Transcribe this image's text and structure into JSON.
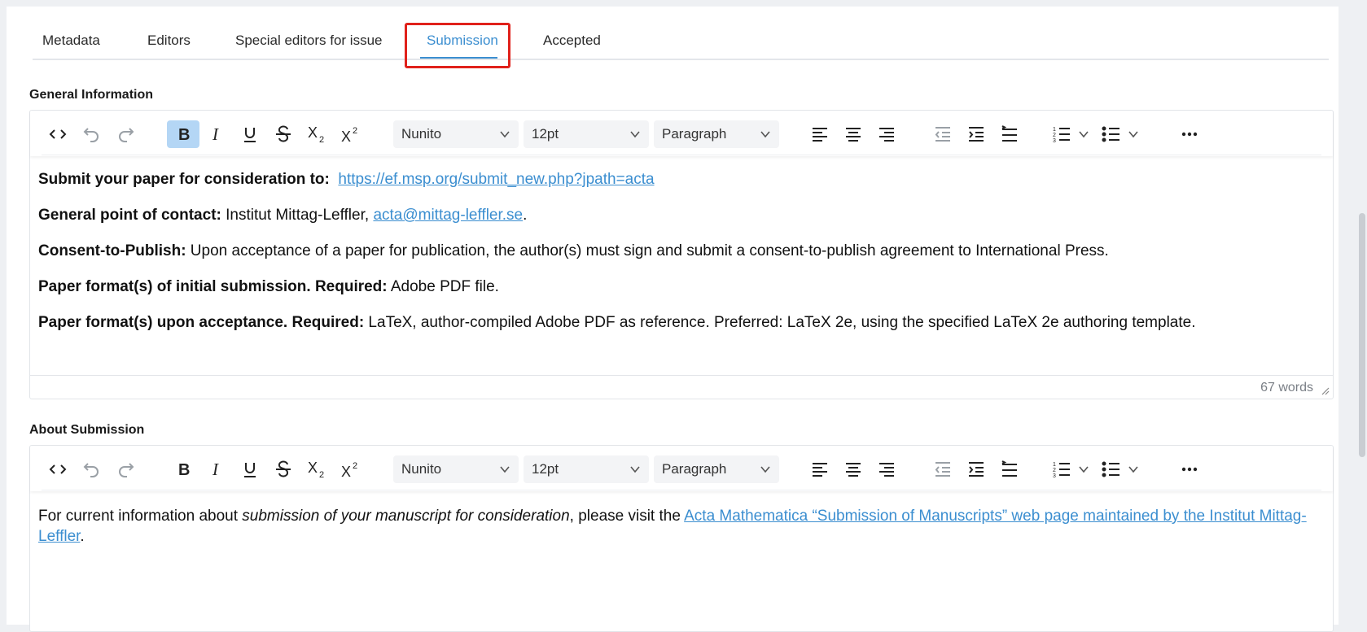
{
  "tabs": [
    {
      "label": "Metadata"
    },
    {
      "label": "Editors"
    },
    {
      "label": "Special editors for issue"
    },
    {
      "label": "Submission"
    },
    {
      "label": "Accepted"
    }
  ],
  "active_tab": "Submission",
  "colors": {
    "accent": "#3b8ed0",
    "highlight": "#e0211b",
    "active_button": "#b4d6f5"
  },
  "toolbar": {
    "font": "Nunito",
    "size": "12pt",
    "block": "Paragraph",
    "icons": [
      "source-code",
      "undo",
      "redo",
      "bold",
      "italic",
      "underline",
      "strikethrough",
      "subscript",
      "superscript",
      "align-left",
      "align-center",
      "align-right",
      "outdent",
      "indent",
      "line-height",
      "numbered-list",
      "bullet-list",
      "more"
    ]
  },
  "general": {
    "label": "General Information",
    "p1_bold": "Submit your paper for consideration to:",
    "p1_link": "https://ef.msp.org/submit_new.php?jpath=acta",
    "p2_bold": "General point of contact:",
    "p2_text": " Institut Mittag-Leffler, ",
    "p2_link": "acta@mittag-leffler.se",
    "p2_end": ".",
    "p3_bold": "Consent-to-Publish:",
    "p3_text": " Upon acceptance of a paper for publication, the author(s) must sign and submit a consent-to-publish agreement to International Press.",
    "p4_bold": "Paper format(s) of initial submission. Required:",
    "p4_text": " Adobe PDF file.",
    "p5_bold": "Paper format(s) upon acceptance. Required:",
    "p5_text": " LaTeX, author-compiled Adobe PDF as reference. Preferred: LaTeX 2e, using the specified LaTeX 2e authoring template.",
    "word_count": "67 words"
  },
  "about": {
    "label": "About Submission",
    "text1": "For current information about ",
    "italic": "submission of your manuscript for consideration",
    "text2": ", please visit the ",
    "link": "Acta Mathematica “Submission of Manuscripts” web page maintained by the Institut Mittag-Leffler",
    "end": "."
  }
}
